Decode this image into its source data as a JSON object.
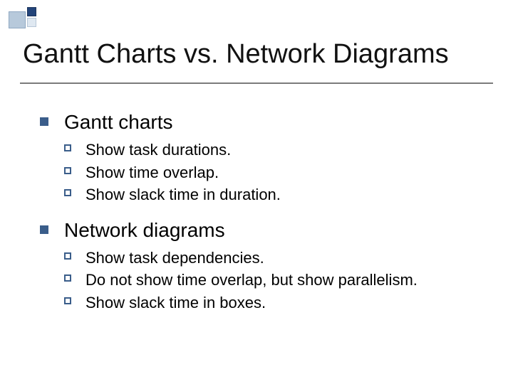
{
  "title": "Gantt Charts vs. Network Diagrams",
  "sections": [
    {
      "heading": "Gantt charts",
      "items": [
        "Show task durations.",
        "Show time overlap.",
        "Show slack time in duration."
      ]
    },
    {
      "heading": "Network diagrams",
      "items": [
        "Show task dependencies.",
        "Do not show time overlap, but show parallelism.",
        "Show slack time in boxes."
      ]
    }
  ]
}
